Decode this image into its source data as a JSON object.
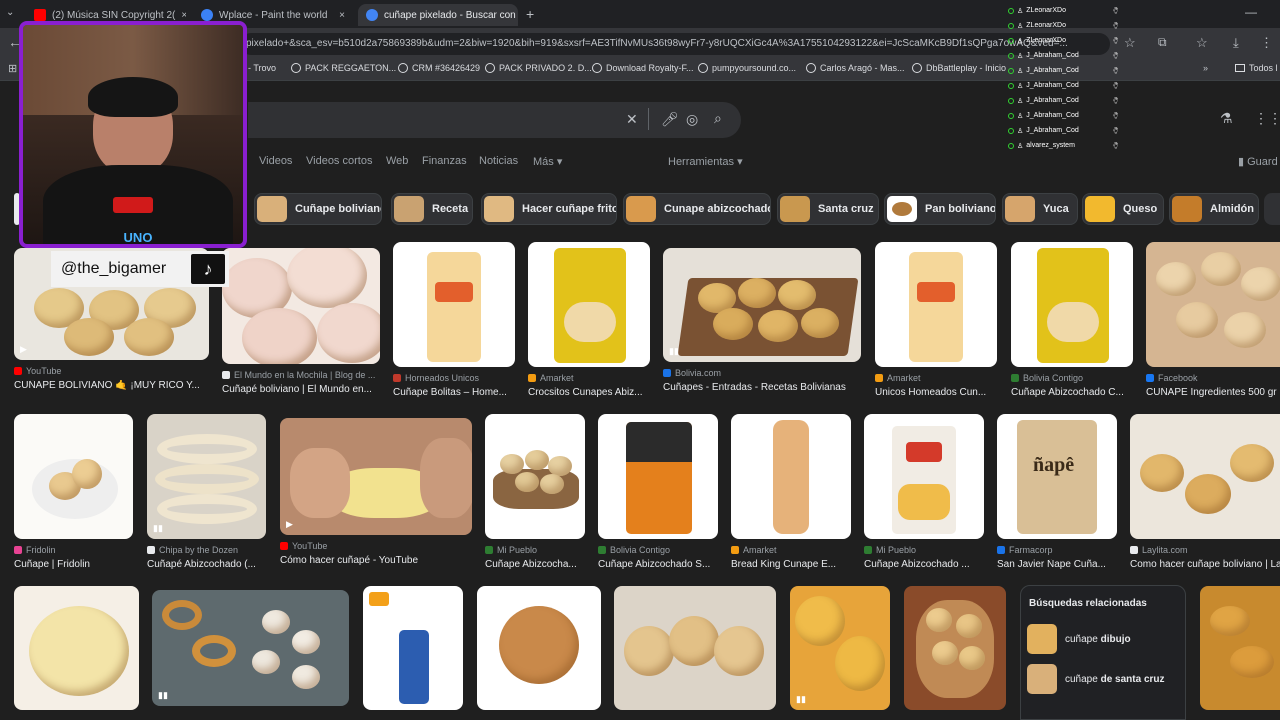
{
  "tabs": [
    {
      "title": "(2) Música SIN Copyright 2(",
      "active": false,
      "favicon_color": "#ff0000"
    },
    {
      "title": "Wplace - Paint the world",
      "active": false,
      "favicon_color": "#3b82f6"
    },
    {
      "title": "cuñape pixelado - Buscar con G",
      "active": true,
      "favicon_color": "#4285f4"
    }
  ],
  "address": {
    "url": "pixelado+&sca_esv=b510d2a75869389b&udm=2&biw=1920&bih=919&sxsrf=AE3TifNvMUs36t98wyFr7-y8rUQCXiGc4A%3A1755104293122&ei=JcScaMKcB9Df1sQPga7owAQ&ved=..."
  },
  "bookmarks": [
    "- Trovo",
    "PACK REGGAETON...",
    "CRM #36426429",
    "PACK PRIVADO 2. D...",
    "Download Royalty-F...",
    "pumpyoursound.co...",
    "Carlos Aragó - Mas...",
    "DbBattleplay - Inicio",
    "Todos l"
  ],
  "nav": {
    "tabs": [
      "Videos",
      "Videos cortos",
      "Web",
      "Finanzas",
      "Noticias",
      "Más ▾"
    ],
    "tools": "Herramientas ▾",
    "save": "Guard"
  },
  "chips": [
    {
      "label": "Cuñape boliviano",
      "color": "#d9b07a"
    },
    {
      "label": "Receta",
      "color": "#c9a271"
    },
    {
      "label": "Hacer cuñape frito",
      "color": "#e0b982"
    },
    {
      "label": "Cunape abizcochado",
      "color": "#d99a4d"
    },
    {
      "label": "Santa cruz",
      "color": "#c9984f"
    },
    {
      "label": "Pan boliviano",
      "color": "#b07a3c"
    },
    {
      "label": "Yuca",
      "color": "#d6a56c"
    },
    {
      "label": "Queso",
      "color": "#f2b92e"
    },
    {
      "label": "Almidón",
      "color": "#c47c2a"
    }
  ],
  "row1": [
    {
      "source": "YouTube",
      "title": "CUÑAPE BOLIVIANO 🤙 ¡MUY RICO Y...",
      "video": true,
      "fav": "#ff0000"
    },
    {
      "source": "El Mundo en la Mochila | Blog de ...",
      "title": "Cuñapé boliviano | El Mundo en...",
      "video": false,
      "fav": "#e8eaed"
    },
    {
      "source": "Horneados Unicos",
      "title": "Cuñape Bolitas – Home...",
      "video": false,
      "fav": "#c0392b"
    },
    {
      "source": "Amarket",
      "title": "Crocsitos Cunapes Abiz...",
      "video": false,
      "fav": "#f39c12"
    },
    {
      "source": "Bolivia.com",
      "title": "Cuñapes - Entradas - Recetas Bolivianas",
      "video": true,
      "fav": "#1a73e8"
    },
    {
      "source": "Amarket",
      "title": "Unicos Homeados Cun...",
      "video": false,
      "fav": "#f39c12"
    },
    {
      "source": "Bolivia Contigo",
      "title": "Cuñape Abizcochado C...",
      "video": false,
      "fav": "#2e7d32"
    },
    {
      "source": "Facebook",
      "title": "CUÑAPE Ingredientes 500 gr",
      "video": false,
      "fav": "#1877f2"
    }
  ],
  "row2": [
    {
      "source": "Fridolin",
      "title": "Cuñape | Fridolin",
      "video": false,
      "fav": "#e84393"
    },
    {
      "source": "Chipa by the Dozen",
      "title": "Cuñapé Abizcochado (...",
      "video": true,
      "fav": "#e8eaed"
    },
    {
      "source": "YouTube",
      "title": "Cómo hacer cuñapé - YouTube",
      "video": true,
      "fav": "#ff0000"
    },
    {
      "source": "Mi Pueblo",
      "title": "Cuñape Abizcocha...",
      "video": false,
      "fav": "#2e7d32"
    },
    {
      "source": "Bolivia Contigo",
      "title": "Cuñape Abizcochado S...",
      "video": false,
      "fav": "#2e7d32"
    },
    {
      "source": "Amarket",
      "title": "Bread King Cunape E...",
      "video": false,
      "fav": "#f39c12"
    },
    {
      "source": "Mi Pueblo",
      "title": "Cuñape Abizcochado ...",
      "video": false,
      "fav": "#2e7d32"
    },
    {
      "source": "Farmacorp",
      "title": "San Javier Ñape Cuña...",
      "video": false,
      "fav": "#1a73e8"
    },
    {
      "source": "Laylita.com",
      "title": "Como hacer cuñape boliviano | La",
      "video": false,
      "fav": "#e8eaed"
    }
  ],
  "related": {
    "heading": "Búsquedas relacionadas",
    "items": [
      {
        "pre": "cuñape ",
        "bold": "dibujo"
      },
      {
        "pre": "cuñape ",
        "bold": "de santa cruz"
      }
    ]
  },
  "chat": [
    "ZLeonarXDo",
    "ZLeonarXDo",
    "ZLeonarXDo",
    "J_Abraham_Cod",
    "J_Abraham_Cod",
    "J_Abraham_Cod",
    "J_Abraham_Cod",
    "J_Abraham_Cod",
    "J_Abraham_Cod",
    "alvarez_system"
  ],
  "overlay": {
    "handle": "@the_bigamer",
    "label_red": "UNO"
  },
  "colors": {
    "bg": "#1f1f1f",
    "webcam_border": "#8a1fd0"
  }
}
